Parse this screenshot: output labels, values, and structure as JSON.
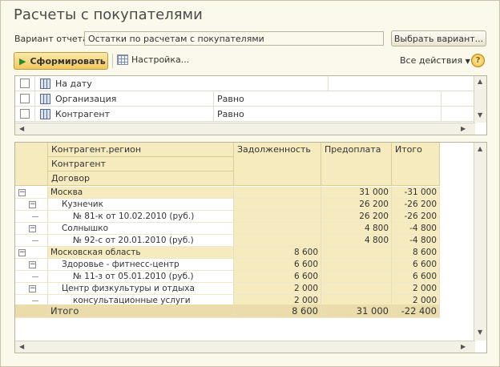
{
  "title": "Расчеты с покупателями",
  "variant": {
    "label": "Вариант отчета:",
    "value": "Остатки по расчетам с покупателями",
    "choose_button": "Выбрать вариант..."
  },
  "toolbar": {
    "form_button": "Сформировать",
    "settings": "Настройка...",
    "all_actions": "Все действия",
    "help": "?"
  },
  "filters": [
    {
      "name": "На дату",
      "condition": ""
    },
    {
      "name": "Организация",
      "condition": "Равно"
    },
    {
      "name": "Контрагент",
      "condition": "Равно"
    }
  ],
  "report": {
    "headers": {
      "group1": "Контрагент.регион",
      "group2": "Контрагент",
      "group3": "Договор",
      "debt": "Задолженность",
      "prepay": "Предоплата",
      "total": "Итого"
    },
    "rows": [
      {
        "name": "Москва",
        "debt": "",
        "prepay": "31 000",
        "total": "-31 000"
      },
      {
        "name": "Кузнечик",
        "debt": "",
        "prepay": "26 200",
        "total": "-26 200"
      },
      {
        "name": "№ 81-к от 10.02.2010 (руб.)",
        "debt": "",
        "prepay": "26 200",
        "total": "-26 200"
      },
      {
        "name": "Солнышко",
        "debt": "",
        "prepay": "4 800",
        "total": "-4 800"
      },
      {
        "name": "№ 92-с от 20.01.2010 (руб.)",
        "debt": "",
        "prepay": "4 800",
        "total": "-4 800"
      },
      {
        "name": "Московская область",
        "debt": "8 600",
        "prepay": "",
        "total": "8 600"
      },
      {
        "name": "Здоровье - фитнесс-центр",
        "debt": "6 600",
        "prepay": "",
        "total": "6 600"
      },
      {
        "name": "№ 11-з от 05.01.2010 (руб.)",
        "debt": "6 600",
        "prepay": "",
        "total": "6 600"
      },
      {
        "name": "Центр физкультуры и отдыха",
        "debt": "2 000",
        "prepay": "",
        "total": "2 000"
      },
      {
        "name": "консультационные услуги",
        "debt": "2 000",
        "prepay": "",
        "total": "2 000"
      }
    ],
    "totals": {
      "label": "Итого",
      "debt": "8 600",
      "prepay": "31 000",
      "total": "-22 400"
    }
  }
}
